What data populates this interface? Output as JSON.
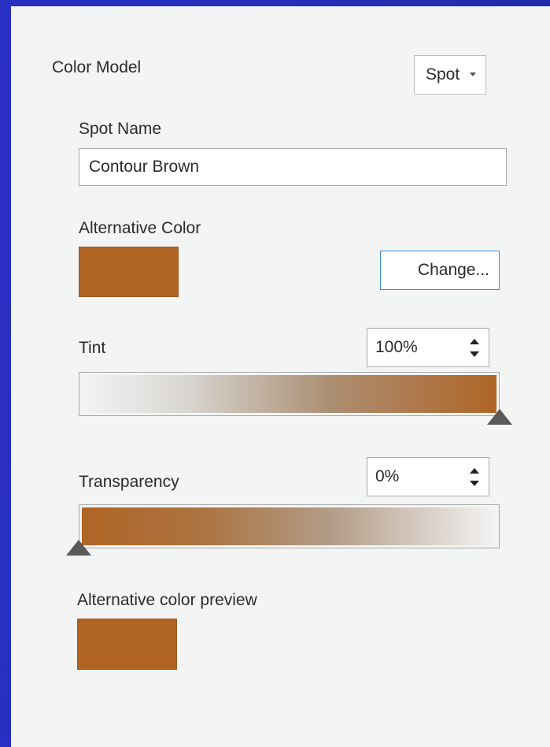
{
  "color_model": {
    "label": "Color Model",
    "selected": "Spot"
  },
  "spot_name": {
    "label": "Spot Name",
    "value": "Contour Brown"
  },
  "alternative_color": {
    "label": "Alternative Color",
    "swatch_color": "#b06525",
    "change_label": "Change..."
  },
  "tint": {
    "label": "Tint",
    "value": "100%",
    "level": 1.0
  },
  "transparency": {
    "label": "Transparency",
    "value": "0%",
    "level": 0.0
  },
  "preview": {
    "label": "Alternative color preview",
    "swatch_color": "#b06525"
  },
  "colors": {
    "accent_border": "#3b8fd6",
    "brown": "#b06525"
  }
}
